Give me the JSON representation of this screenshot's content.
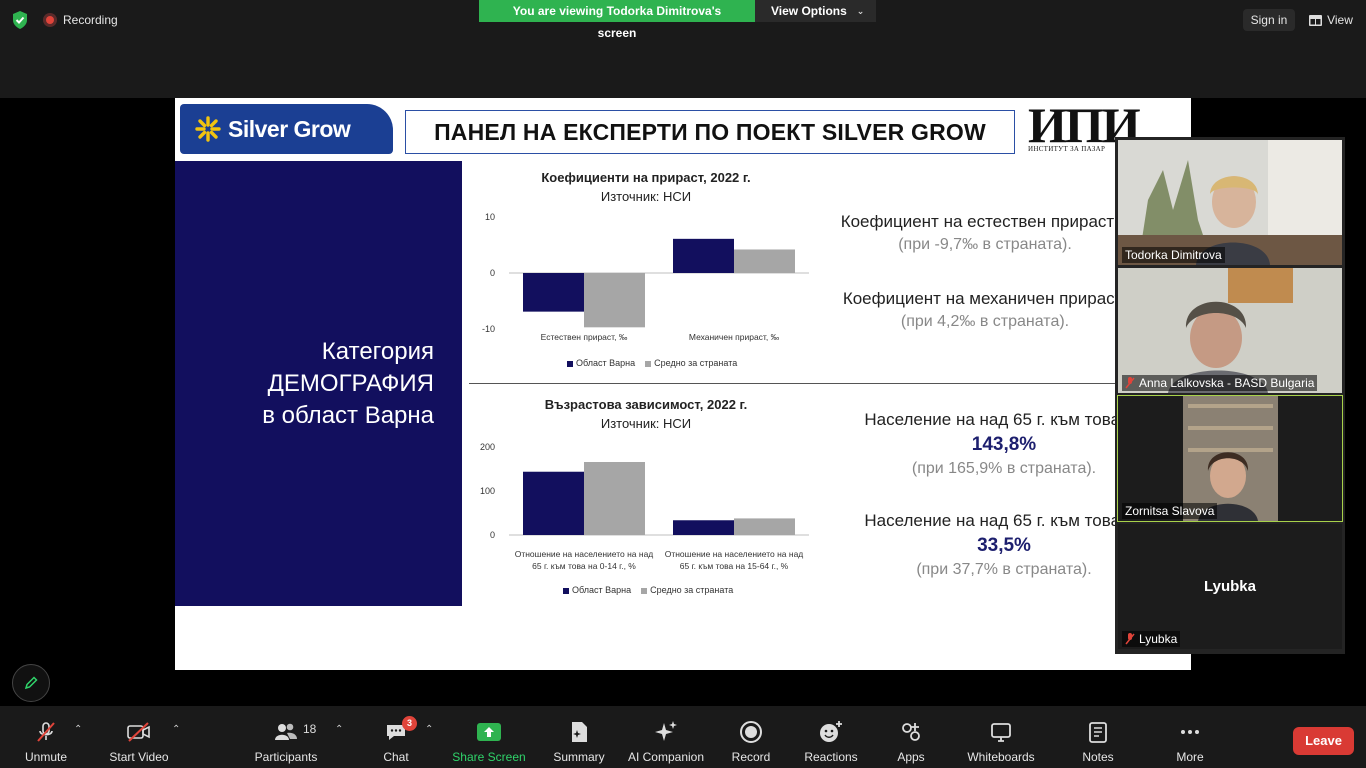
{
  "topbar": {
    "recording_label": "Recording",
    "banner_text": "You are viewing Todorka Dimitrova's screen",
    "view_options_label": "View Options",
    "signin_label": "Sign in",
    "view_label": "View"
  },
  "slide": {
    "logo_text": "Silver Grow",
    "title": "ПАНЕЛ НА ЕКСПЕРТИ ПО ПОЕКТ SILVER GROW",
    "ipi_logo": "ИПИ",
    "ipi_sub": "ИНСТИТУТ ЗА ПАЗАР",
    "category_line1": "Категория",
    "category_line2": "ДЕМОГРАФИЯ",
    "category_line3": "в област Варна",
    "stats": [
      {
        "label": "Коефициент на естествен прираст: -",
        "big": "",
        "note": "(при -9,7‰ в страната)."
      },
      {
        "label": "Коефициент на механичен прираст:",
        "big": "",
        "note": "(при 4,2‰ в страната)."
      },
      {
        "label": "Население на над 65 г. към това на",
        "big": "143,8%",
        "note": "(при 165,9% в страната)."
      },
      {
        "label": "Население на над 65 г. към това на",
        "big": "33,5%",
        "note": "(при 37,7% в страната)."
      }
    ]
  },
  "chart_data": [
    {
      "type": "bar",
      "title": "Коефициенти на прираст, 2022 г.",
      "subtitle": "Източник: НСИ",
      "categories": [
        "Естествен прираст, ‰",
        "Механичен прираст, ‰"
      ],
      "series": [
        {
          "name": "Област Варна",
          "values": [
            -6.9,
            6.1
          ],
          "color": "#120f5e"
        },
        {
          "name": "Средно за страната",
          "values": [
            -9.7,
            4.2
          ],
          "color": "#a6a6a6"
        }
      ],
      "ylim": [
        -10,
        10
      ],
      "yticks": [
        "10",
        "0",
        "-10"
      ],
      "grid": false,
      "legend": "bottom"
    },
    {
      "type": "bar",
      "title": "Възрастова зависимост, 2022 г.",
      "subtitle": "Източник: НСИ",
      "categories": [
        "Отношение на населението на над 65 г. към това на 0-14 г., %",
        "Отношение на населението на над 65 г. към това на 15-64 г., %"
      ],
      "category_lines": [
        [
          "Отношение на населението на над",
          "65 г. към това на 0-14 г., %"
        ],
        [
          "Отношение на населението на над",
          "65 г. към това на 15-64 г., %"
        ]
      ],
      "series": [
        {
          "name": "Област Варна",
          "values": [
            143.8,
            33.5
          ],
          "color": "#120f5e"
        },
        {
          "name": "Средно за страната",
          "values": [
            165.9,
            37.7
          ],
          "color": "#a6a6a6"
        }
      ],
      "ylim": [
        0,
        200
      ],
      "yticks": [
        "200",
        "100",
        "0"
      ],
      "grid": false,
      "legend": "bottom"
    }
  ],
  "participants": [
    {
      "name": "Todorka Dimitrova",
      "muted": false
    },
    {
      "name": "Anna Lalkovska - BASD Bulgaria",
      "muted": true
    },
    {
      "name": "Zornitsa Slavova",
      "muted": false
    },
    {
      "name": "Lyubka",
      "muted": true,
      "display": "Lyubka"
    }
  ],
  "toolbar": {
    "unmute": "Unmute",
    "start_video": "Start Video",
    "participants": "Participants",
    "participants_count": "18",
    "chat": "Chat",
    "chat_badge": "3",
    "share_screen": "Share Screen",
    "summary": "Summary",
    "ai_companion": "AI Companion",
    "record": "Record",
    "reactions": "Reactions",
    "apps": "Apps",
    "whiteboards": "Whiteboards",
    "notes": "Notes",
    "more": "More",
    "leave": "Leave",
    "accent_green": "#2fd36a",
    "leave_color": "#d93a34"
  }
}
